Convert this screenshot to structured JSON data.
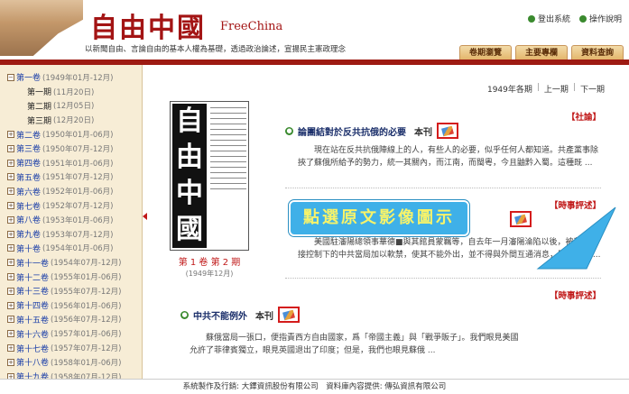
{
  "header": {
    "title": "自由中國",
    "subtitle": "FreeChina",
    "tagline": "以新聞自由、言論自由的基本人權為基礎，透過政治論述，宣揚民主憲政理念",
    "links": [
      {
        "label": "登出系統",
        "icon": "logout-icon"
      },
      {
        "label": "操作說明",
        "icon": "help-icon"
      }
    ],
    "tabs": [
      "卷期瀏覽",
      "主要專欄",
      "資料查詢"
    ]
  },
  "sidebar": {
    "volumes": [
      {
        "name": "第一卷",
        "date": "(1949年01月-12月)",
        "expanded": true
      },
      {
        "name": "第一期",
        "date": "(11月20日)",
        "sub": true
      },
      {
        "name": "第二期",
        "date": "(12月05日)",
        "sub": true
      },
      {
        "name": "第三期",
        "date": "(12月20日)",
        "sub": true
      },
      {
        "name": "第二卷",
        "date": "(1950年01月-06月)"
      },
      {
        "name": "第三卷",
        "date": "(1950年07月-12月)"
      },
      {
        "name": "第四卷",
        "date": "(1951年01月-06月)"
      },
      {
        "name": "第五卷",
        "date": "(1951年07月-12月)"
      },
      {
        "name": "第六卷",
        "date": "(1952年01月-06月)"
      },
      {
        "name": "第七卷",
        "date": "(1952年07月-12月)"
      },
      {
        "name": "第八卷",
        "date": "(1953年01月-06月)"
      },
      {
        "name": "第九卷",
        "date": "(1953年07月-12月)"
      },
      {
        "name": "第十卷",
        "date": "(1954年01月-06月)"
      },
      {
        "name": "第十一卷",
        "date": "(1954年07月-12月)"
      },
      {
        "name": "第十二卷",
        "date": "(1955年01月-06月)"
      },
      {
        "name": "第十三卷",
        "date": "(1955年07月-12月)"
      },
      {
        "name": "第十四卷",
        "date": "(1956年01月-06月)"
      },
      {
        "name": "第十五卷",
        "date": "(1956年07月-12月)"
      },
      {
        "name": "第十六卷",
        "date": "(1957年01月-06月)"
      },
      {
        "name": "第十七卷",
        "date": "(1957年07月-12月)"
      },
      {
        "name": "第十八卷",
        "date": "(1958年01月-06月)"
      },
      {
        "name": "第十九卷",
        "date": "(1958年07月-12月)"
      },
      {
        "name": "第二十卷",
        "date": "(1959年01月-06月)"
      }
    ]
  },
  "issue_nav": {
    "current": "1949年各期",
    "prev": "上一期",
    "next": "下一期"
  },
  "cover": {
    "masthead": [
      "自",
      "由",
      "中",
      "國"
    ],
    "issue": "第 1 卷 第 2 期",
    "date": "(1949年12月)"
  },
  "articles": [
    {
      "category": "【社論】",
      "title": "論團結對於反共抗俄的必要",
      "author": "本刊",
      "body": "現在站在反共抗俄陣線上的人，有些人的必要，似乎任何人都知道。共產黨事除挾了蘇俄所給予的勢力，統一其關內，而江南，而閩粵，今且鼬黔入蜀。這種既 ..."
    },
    {
      "category": "【時事評述】",
      "title": "",
      "author": "",
      "body": "美國駐瀋陽總領事華德■與其館員蒙羈等，自去年一月瀋陽淪陷以後，被蘇俄直接控制下的中共當局加以軟禁，使其不能外出，並不得與外間互通消息，即他們與 ..."
    },
    {
      "category": "【時事評述】",
      "title": "中共不能例外",
      "author": "本刊",
      "body": "蘇俄當局一張口，便指責西方自由國家，爲「帝國主義」與「戰爭販子」。我們眼見美國允許了菲律賓獨立，眼見英國退出了印度；但是，我們也眼見蘇俄 ..."
    }
  ],
  "callout": "點選原文影像圖示",
  "footer": "系統製作及行銷: 大鐸資訊股份有限公司　資料庫內容提供: 傳弘資訊有限公司",
  "colors": {
    "brand_red": "#a31414",
    "link_blue": "#1a3ea8",
    "callout_bg": "#3fb0e8",
    "callout_text": "#f7f36a"
  }
}
